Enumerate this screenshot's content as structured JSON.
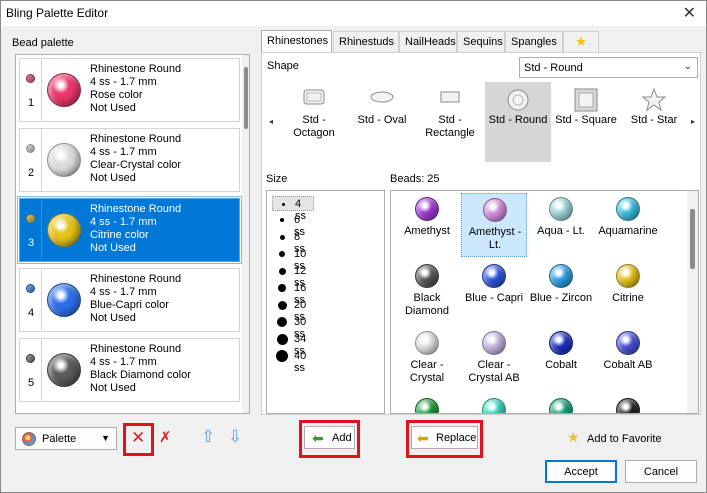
{
  "window": {
    "title": "Bling Palette Editor",
    "close_glyph": "✕"
  },
  "left": {
    "label": "Bead palette",
    "items": [
      {
        "num": "1",
        "name": "Rhinestone Round",
        "size": "4 ss - 1.7 mm",
        "color": "Rose color",
        "status": "Not Used",
        "swatch": "#e8356a"
      },
      {
        "num": "2",
        "name": "Rhinestone Round",
        "size": "4 ss - 1.7 mm",
        "color": "Clear-Crystal color",
        "status": "Not Used",
        "swatch": "#dcdcdc"
      },
      {
        "num": "3",
        "name": "Rhinestone Round",
        "size": "4 ss - 1.7 mm",
        "color": "Citrine color",
        "status": "Not Used",
        "swatch": "#e6c21a",
        "selected": true
      },
      {
        "num": "4",
        "name": "Rhinestone Round",
        "size": "4 ss - 1.7 mm",
        "color": "Blue-Capri color",
        "status": "Not Used",
        "swatch": "#2d6fe8"
      },
      {
        "num": "5",
        "name": "Rhinestone Round",
        "size": "4 ss - 1.7 mm",
        "color": "Black Diamond color",
        "status": "Not Used",
        "swatch": "#5a5a5a"
      }
    ],
    "palette_combo": "Palette"
  },
  "tabs": [
    "Rhinestones",
    "Rhinestuds",
    "NailHeads",
    "Sequins",
    "Spangles",
    "★"
  ],
  "shape": {
    "label": "Shape",
    "selected": "Std - Round",
    "items": [
      {
        "name": "Std - Octagon",
        "icon": "octagon-icon"
      },
      {
        "name": "Std - Oval",
        "icon": "oval-icon"
      },
      {
        "name": "Std - Rectangle",
        "icon": "rectangle-icon"
      },
      {
        "name": "Std - Round",
        "icon": "round-icon",
        "selected": true
      },
      {
        "name": "Std - Square",
        "icon": "square-icon"
      },
      {
        "name": "Std - Star",
        "icon": "star-icon"
      }
    ]
  },
  "size": {
    "label": "Size",
    "items": [
      "4 ss",
      "6 ss",
      "8 ss",
      "10 ss",
      "12 ss",
      "16 ss",
      "20 ss",
      "30 ss",
      "34 ss",
      "40 ss"
    ],
    "selected": "4 ss"
  },
  "beads": {
    "label": "Beads: 25",
    "items": [
      {
        "name": "Amethyst",
        "color": "#a23ad6"
      },
      {
        "name": "Amethyst - Lt.",
        "color": "#d68ee0",
        "selected": true
      },
      {
        "name": "Aqua - Lt.",
        "color": "#9fd8e0"
      },
      {
        "name": "Aquamarine",
        "color": "#38c3e0"
      },
      {
        "name": "Black Diamond",
        "color": "#555555"
      },
      {
        "name": "Blue - Capri",
        "color": "#2d55e0"
      },
      {
        "name": "Blue - Zircon",
        "color": "#2ba0e8"
      },
      {
        "name": "Citrine",
        "color": "#e6c21a"
      },
      {
        "name": "Clear - Crystal",
        "color": "#e4e4e4"
      },
      {
        "name": "Clear - Crystal AB",
        "color": "#c7b6e6"
      },
      {
        "name": "Cobalt",
        "color": "#1d2fc0"
      },
      {
        "name": "Cobalt AB",
        "color": "#4950d8"
      },
      {
        "name": "",
        "color": "#1f9a3a"
      },
      {
        "name": "",
        "color": "#3ad6c4"
      },
      {
        "name": "",
        "color": "#1ca07a"
      },
      {
        "name": "",
        "color": "#222222"
      }
    ]
  },
  "buttons": {
    "add": "Add",
    "replace": "Replace",
    "add_favorite": "Add to Favorite",
    "accept": "Accept",
    "cancel": "Cancel"
  },
  "colors": {
    "highlight": "#e0121f",
    "selection": "#0078d7"
  }
}
